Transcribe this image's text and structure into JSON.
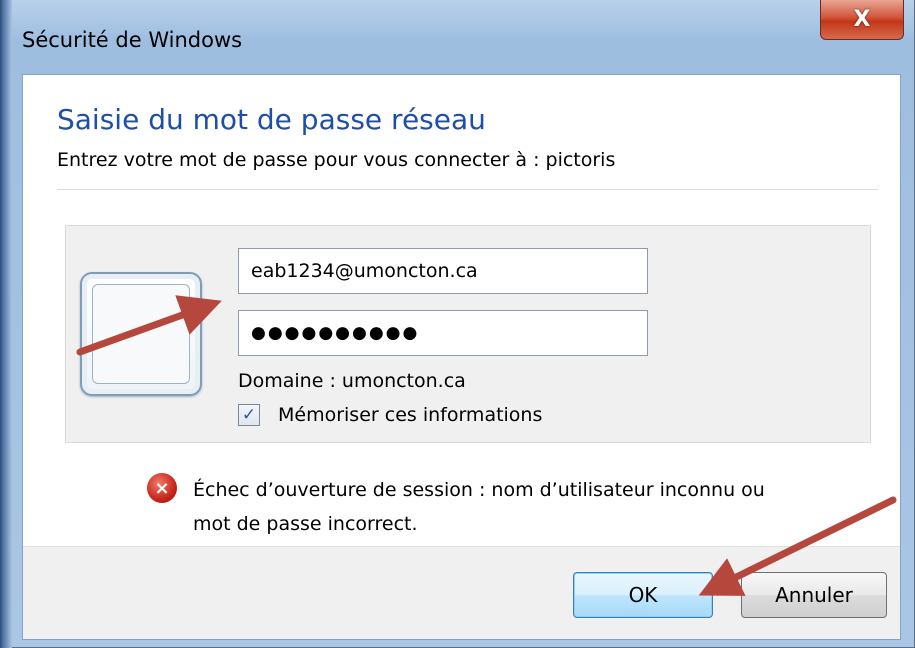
{
  "window": {
    "title": "Sécurité de Windows",
    "close_glyph": "X"
  },
  "dialog": {
    "heading": "Saisie du mot de passe réseau",
    "subtitle": "Entrez votre mot de passe pour vous connecter à : pictoris"
  },
  "credentials": {
    "username_value": "eab1234@umoncton.ca",
    "password_mask": "●●●●●●●●●●",
    "domain_text": "Domaine : umoncton.ca",
    "remember_checked": true,
    "remember_mark": "✓",
    "remember_label": "Mémoriser ces informations"
  },
  "error": {
    "icon": "error-icon",
    "icon_glyph": "×",
    "line1": "Échec d’ouverture de session : nom d’utilisateur inconnu ou",
    "line2": "mot de passe incorrect."
  },
  "buttons": {
    "ok_label": "OK",
    "cancel_label": "Annuler"
  },
  "colors": {
    "heading": "#1e4fa8",
    "annotation_arrow": "#b5473c",
    "close_button": "#c23619"
  }
}
